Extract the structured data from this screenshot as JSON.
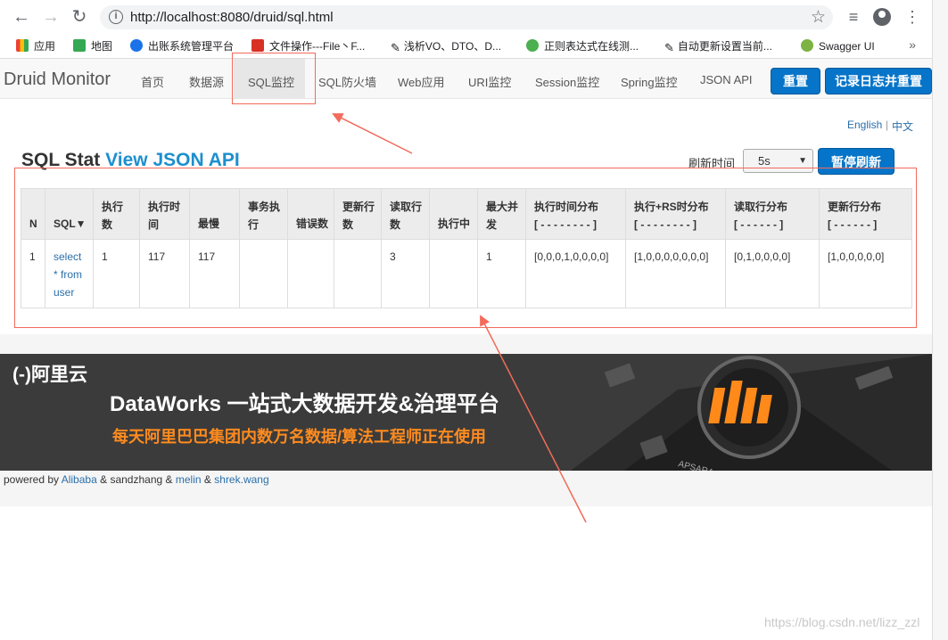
{
  "browser": {
    "url": "http://localhost:8080/druid/sql.html",
    "bookmarks": [
      {
        "label": "应用",
        "color": "#4285f4"
      },
      {
        "label": "地图",
        "color": "#34a853"
      },
      {
        "label": "出账系统管理平台",
        "color": "#1a73e8"
      },
      {
        "label": "文件操作---File丶F...",
        "color": "#d93025"
      },
      {
        "label": "浅析VO、DTO、D...",
        "color": "#333333"
      },
      {
        "label": "正则表达式在线测...",
        "color": "#4caf50"
      },
      {
        "label": "自动更新设置当前...",
        "color": "#333333"
      },
      {
        "label": "Swagger UI",
        "color": "#7cb342"
      }
    ],
    "more": "»"
  },
  "navbar": {
    "brand": "Druid Monitor",
    "items": [
      "首页",
      "数据源",
      "SQL监控",
      "SQL防火墙",
      "Web应用",
      "URI监控",
      "Session监控",
      "Spring监控",
      "JSON API"
    ],
    "active_index": 2,
    "reset_label": "重置",
    "log_reset_label": "记录日志并重置"
  },
  "lang": {
    "english": "English",
    "sep": "|",
    "chinese": "中文"
  },
  "page": {
    "title": "SQL Stat",
    "title_link": "View JSON API",
    "refresh_label": "刷新时间",
    "refresh_value": "5s",
    "pause_label": "暂停刷新"
  },
  "table": {
    "headers": [
      [
        "N"
      ],
      [
        "SQL▼"
      ],
      [
        "执行",
        "数"
      ],
      [
        "执行时",
        "间"
      ],
      [
        "最慢"
      ],
      [
        "事务执",
        "行"
      ],
      [
        "错误数"
      ],
      [
        "更新行",
        "数"
      ],
      [
        "读取行",
        "数"
      ],
      [
        "执行中"
      ],
      [
        "最大并",
        "发"
      ],
      [
        "执行时间分布",
        "[ - - - - - - - - ]"
      ],
      [
        "执行+RS时分布",
        "[ - - - - - - - - ]"
      ],
      [
        "读取行分布",
        "[ - - - - - - ]"
      ],
      [
        "更新行分布",
        "[ - - - - - - ]"
      ]
    ],
    "row": {
      "n": "1",
      "sql": [
        "select",
        "* from",
        "user"
      ],
      "exec_count": "1",
      "exec_time": "117",
      "slowest": "117",
      "tx_exec": "",
      "errors": "",
      "update_rows": "",
      "read_rows": "3",
      "running": "",
      "max_concurrent": "1",
      "exec_time_dist": "[0,0,0,1,0,0,0,0]",
      "exec_rs_dist": "[1,0,0,0,0,0,0,0]",
      "read_rows_dist": "[0,1,0,0,0,0]",
      "update_rows_dist": "[1,0,0,0,0,0]"
    }
  },
  "banner": {
    "logo": "(-)阿里云",
    "product": "DataWorks 一站式大数据开发&治理平台",
    "tagline": "每天阿里巴巴集团内数万名数据/算法工程师正在使用",
    "apsara": "APSARA"
  },
  "footer": {
    "prefix": "powered by",
    "alibaba": "Alibaba",
    "amp1": "&",
    "sandzhang": "sandzhang",
    "amp2": "&",
    "melin": "melin",
    "amp3": "&",
    "shrek": "shrek.wang"
  },
  "watermark": "https://blog.csdn.net/lizz_zzl",
  "colors": {
    "primary": "#0674c8",
    "link": "#2a6faa",
    "annotation": "#f26b5b"
  }
}
